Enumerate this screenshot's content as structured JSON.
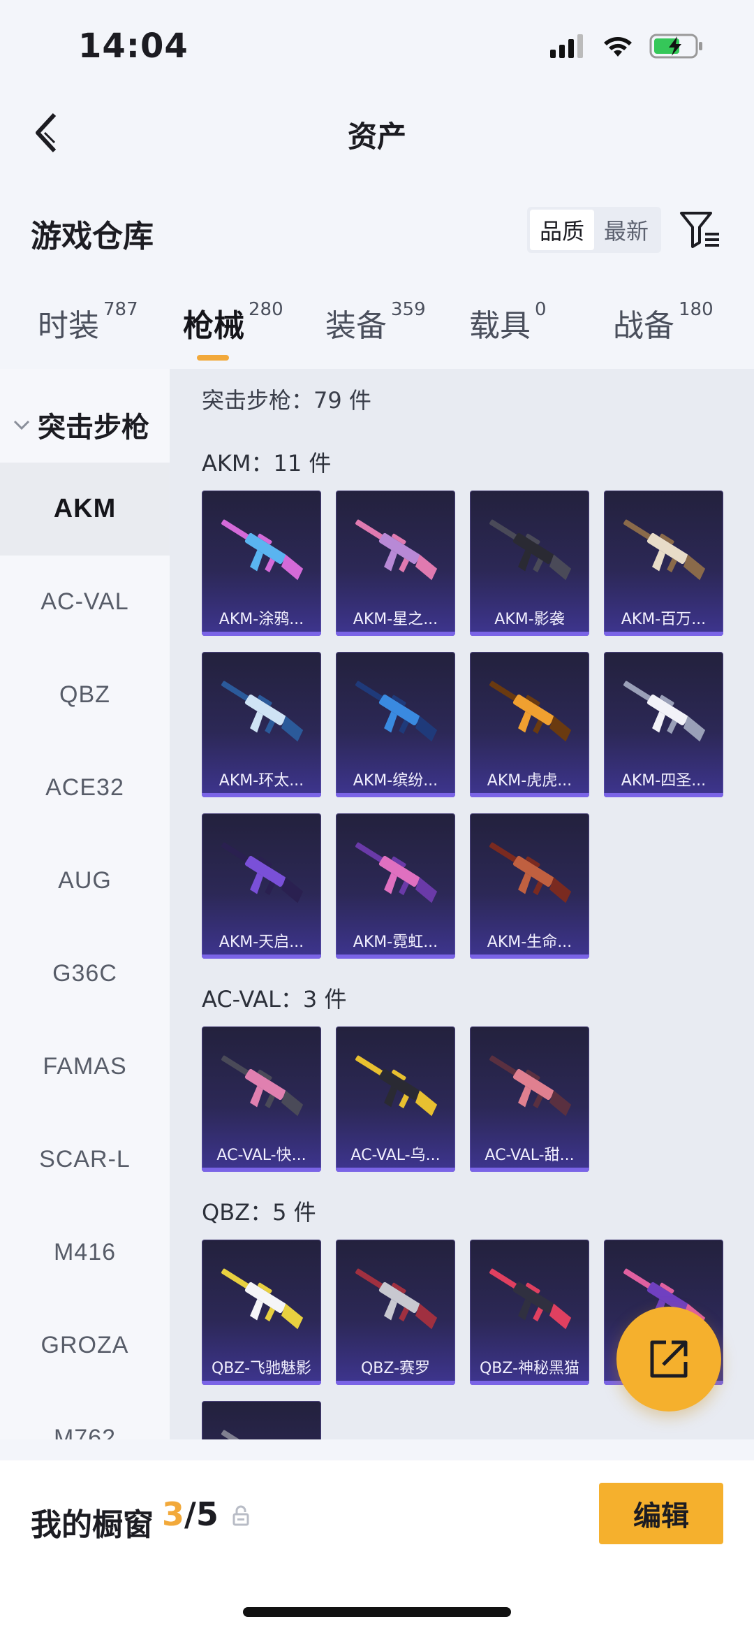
{
  "status_bar": {
    "time": "14:04"
  },
  "nav": {
    "title": "资产"
  },
  "warehouse": {
    "title": "游戏仓库",
    "sort_options": [
      "品质",
      "最新"
    ]
  },
  "category_tabs": [
    {
      "label": "时装",
      "count": "787"
    },
    {
      "label": "枪械",
      "count": "280"
    },
    {
      "label": "装备",
      "count": "359"
    },
    {
      "label": "载具",
      "count": "0"
    },
    {
      "label": "战备",
      "count": "180"
    }
  ],
  "sidebar": {
    "header": "突击步枪",
    "items": [
      "AKM",
      "AC-VAL",
      "QBZ",
      "ACE32",
      "AUG",
      "G36C",
      "FAMAS",
      "SCAR-L",
      "M416",
      "GROZA",
      "M762"
    ]
  },
  "content": {
    "total_label": "突击步枪：79 件",
    "groups": [
      {
        "label": "AKM：11 件",
        "items": [
          "AKM-涂鸦...",
          "AKM-星之...",
          "AKM-影袭",
          "AKM-百万...",
          "AKM-环太...",
          "AKM-缤纷...",
          "AKM-虎虎...",
          "AKM-四圣...",
          "AKM-天启...",
          "AKM-霓虹...",
          "AKM-生命..."
        ]
      },
      {
        "label": "AC-VAL：3 件",
        "items": [
          "AC-VAL-快...",
          "AC-VAL-乌...",
          "AC-VAL-甜..."
        ]
      },
      {
        "label": "QBZ：5 件",
        "items": [
          "QBZ-飞驰魅影",
          "QBZ-赛罗",
          "QBZ-神秘黑猫",
          "",
          ""
        ]
      }
    ]
  },
  "showcase": {
    "label": "我的橱窗",
    "current": "3",
    "total": "/5"
  },
  "edit_button": "编辑",
  "colors": {
    "accent": "#f5b02d",
    "card_bg": "#2c2856",
    "card_bar": "#7a64e6"
  }
}
